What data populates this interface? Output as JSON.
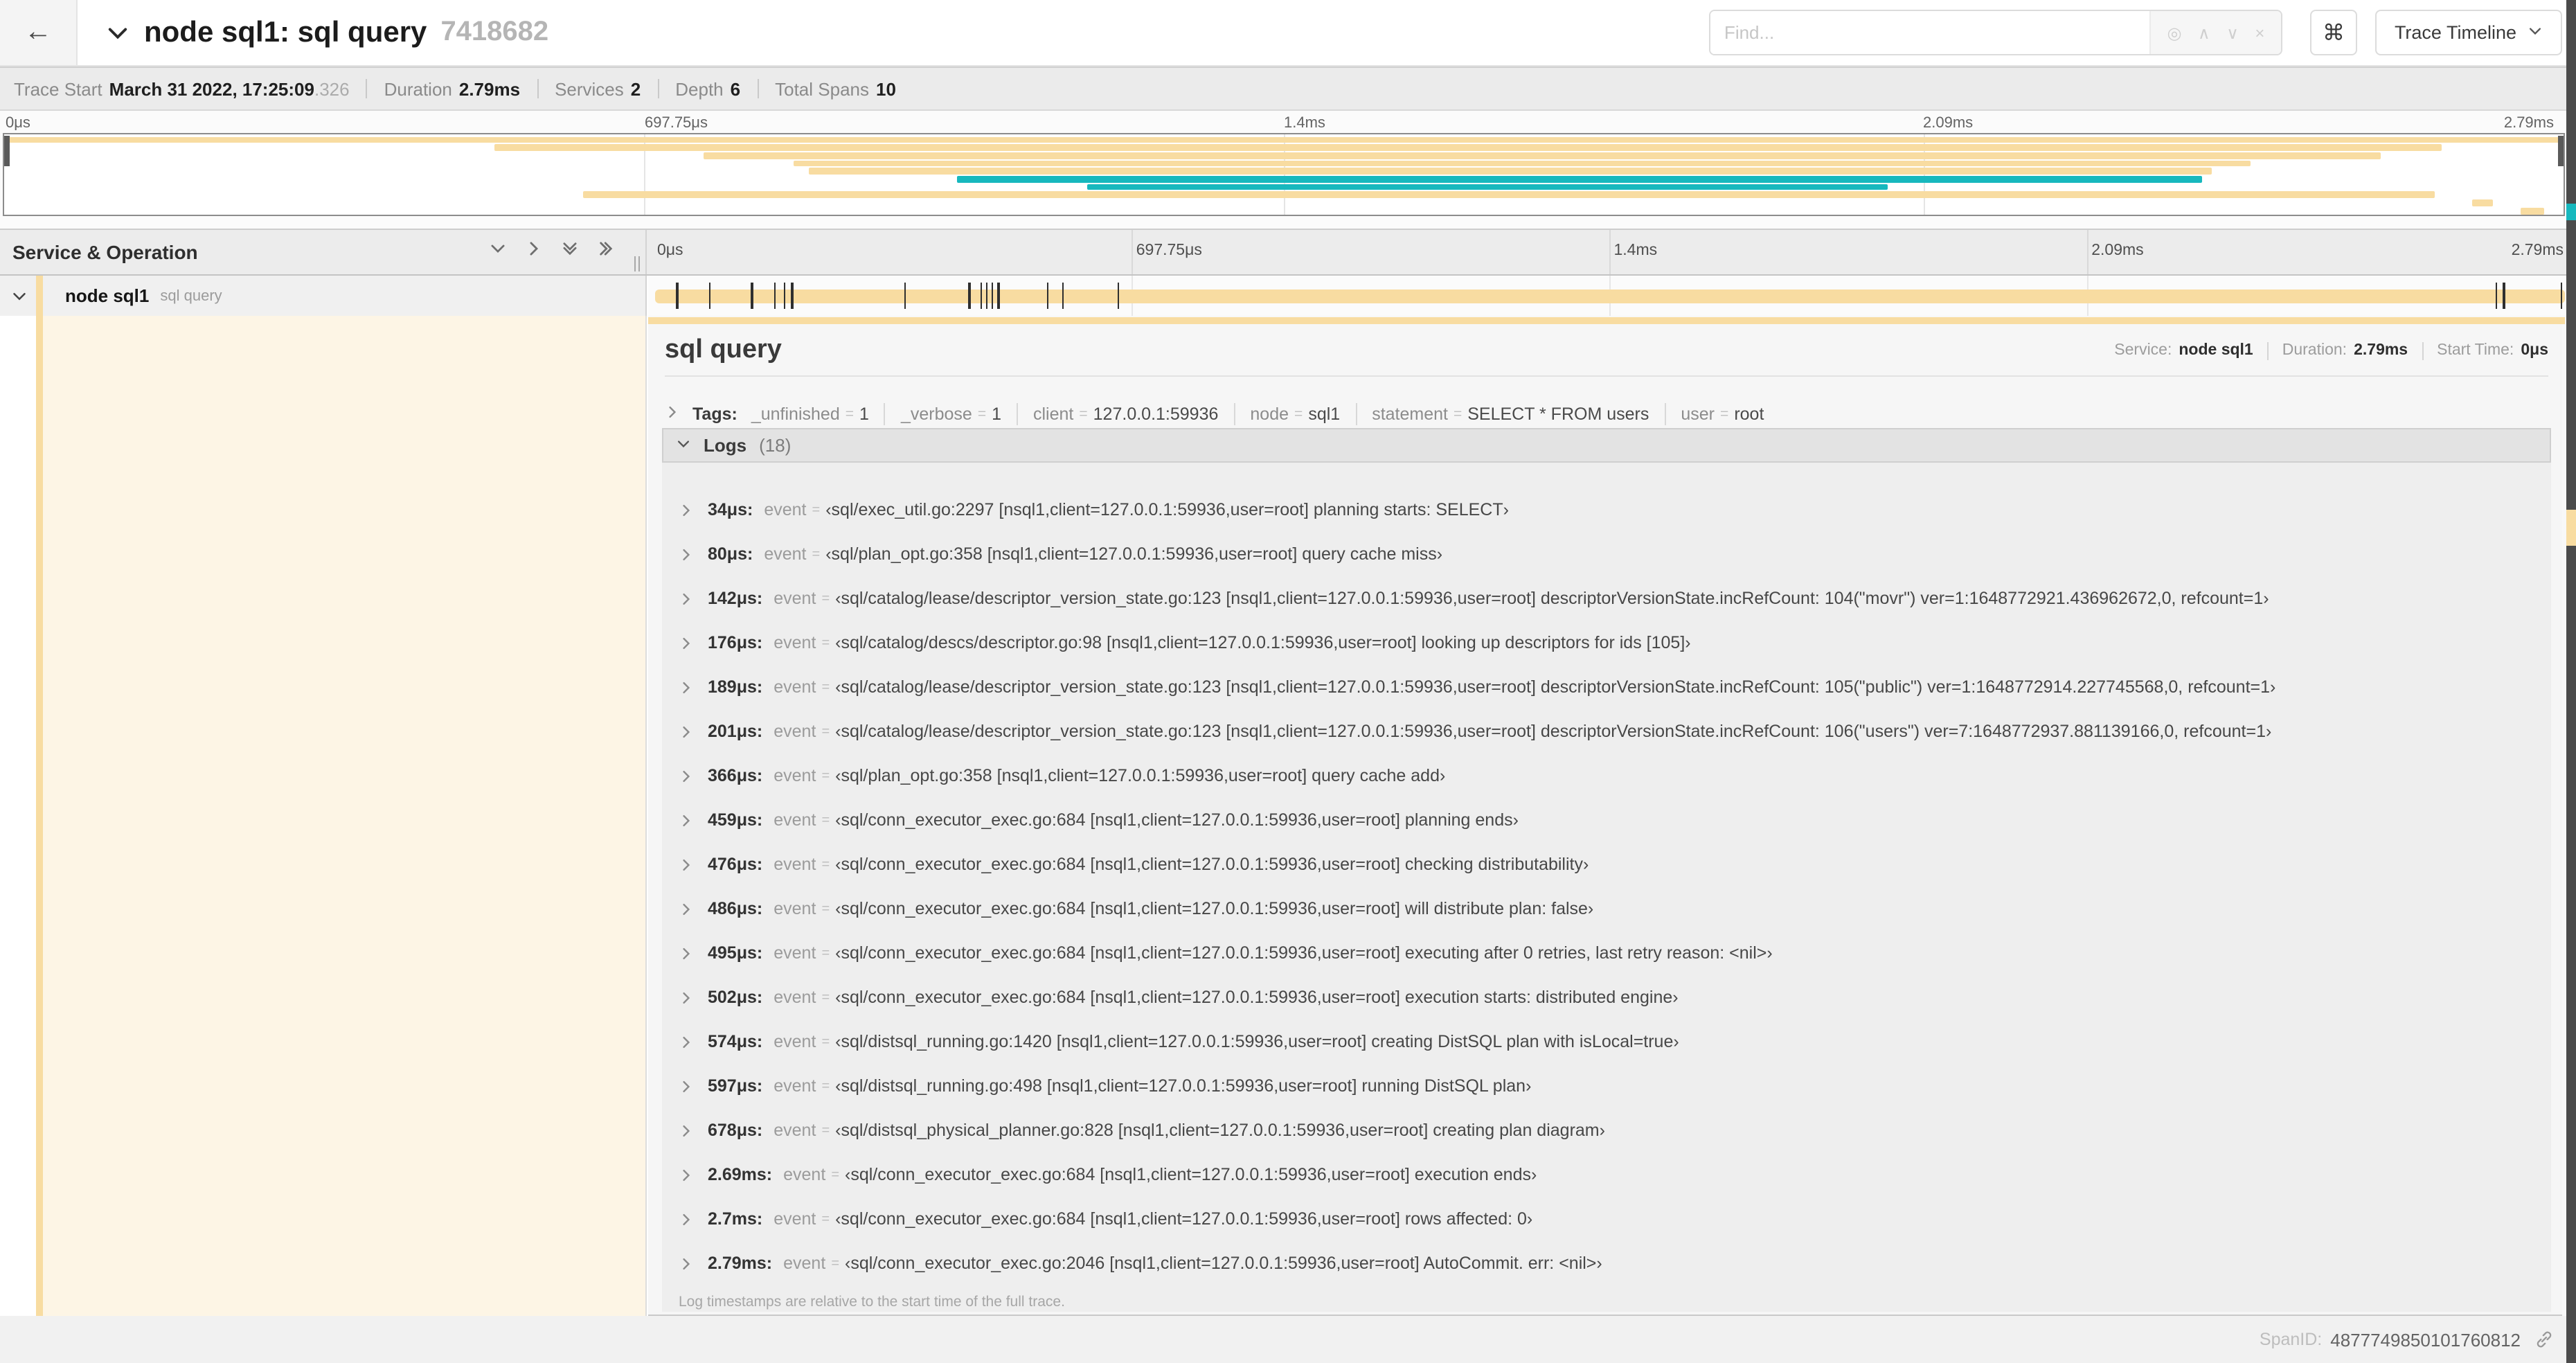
{
  "header": {
    "back_icon": "←",
    "title": "node sql1: sql query",
    "trace_id": "7418682",
    "find_placeholder": "Find...",
    "shortcut_icon": "⌘",
    "view_selector": "Trace Timeline"
  },
  "summary": {
    "trace_start_label": "Trace Start",
    "trace_start_value": "March 31 2022, 17:25:09",
    "trace_start_fraction": ".326",
    "duration_label": "Duration",
    "duration_value": "2.79ms",
    "services_label": "Services",
    "services_value": "2",
    "depth_label": "Depth",
    "depth_value": "6",
    "total_spans_label": "Total Spans",
    "total_spans_value": "10"
  },
  "colors": {
    "tan": "#F8DCA1",
    "teal": "#17B8BE"
  },
  "timeline": {
    "left_header": "Service & Operation",
    "ticks": [
      {
        "label": "0μs",
        "pct": 0
      },
      {
        "label": "697.75μs",
        "pct": 25
      },
      {
        "label": "1.4ms",
        "pct": 50
      },
      {
        "label": "2.09ms",
        "pct": 75
      },
      {
        "label": "2.79ms",
        "pct": 100
      }
    ],
    "row": {
      "service": "node sql1",
      "operation": "sql query"
    },
    "event_marks_pct": [
      1.2,
      2.9,
      5.1,
      6.3,
      6.8,
      7.2,
      13.1,
      16.5,
      17.1,
      17.4,
      17.7,
      18.0,
      20.6,
      21.4,
      24.3,
      96.4,
      96.8,
      99.8
    ]
  },
  "minimap": {
    "spans": [
      {
        "start": 0,
        "end": 100,
        "color": "tan"
      },
      {
        "start": 19.1,
        "end": 95.3,
        "color": "tan"
      },
      {
        "start": 27.3,
        "end": 92.9,
        "color": "tan"
      },
      {
        "start": 30.8,
        "end": 87.8,
        "color": "tan"
      },
      {
        "start": 31.4,
        "end": 86.3,
        "color": "tan"
      },
      {
        "start": 37.2,
        "end": 85.9,
        "color": "teal"
      },
      {
        "start": 42.3,
        "end": 73.6,
        "color": "teal"
      },
      {
        "start": 22.6,
        "end": 95.0,
        "color": "tan"
      },
      {
        "start": 96.5,
        "end": 97.3,
        "color": "tan"
      },
      {
        "start": 98.4,
        "end": 99.3,
        "color": "tan"
      }
    ]
  },
  "detail": {
    "title": "sql query",
    "service_label": "Service:",
    "service_value": "node sql1",
    "duration_label": "Duration:",
    "duration_value": "2.79ms",
    "start_label": "Start Time:",
    "start_value": "0μs",
    "tags_label": "Tags:",
    "tags": [
      {
        "key": "_unfinished",
        "value": "1"
      },
      {
        "key": "_verbose",
        "value": "1"
      },
      {
        "key": "client",
        "value": "127.0.0.1:59936"
      },
      {
        "key": "node",
        "value": "sql1"
      },
      {
        "key": "statement",
        "value": "SELECT * FROM users"
      },
      {
        "key": "user",
        "value": "root"
      }
    ],
    "logs_label": "Logs",
    "logs_count": "(18)",
    "log_field_key": "event",
    "logs": [
      {
        "time": "34μs:",
        "value": "‹sql/exec_util.go:2297 [nsql1,client=127.0.0.1:59936,user=root] planning starts: SELECT›"
      },
      {
        "time": "80μs:",
        "value": "‹sql/plan_opt.go:358 [nsql1,client=127.0.0.1:59936,user=root] query cache miss›"
      },
      {
        "time": "142μs:",
        "value": "‹sql/catalog/lease/descriptor_version_state.go:123 [nsql1,client=127.0.0.1:59936,user=root] descriptorVersionState.incRefCount: 104(\"movr\") ver=1:1648772921.436962672,0, refcount=1›"
      },
      {
        "time": "176μs:",
        "value": "‹sql/catalog/descs/descriptor.go:98 [nsql1,client=127.0.0.1:59936,user=root] looking up descriptors for ids [105]›"
      },
      {
        "time": "189μs:",
        "value": "‹sql/catalog/lease/descriptor_version_state.go:123 [nsql1,client=127.0.0.1:59936,user=root] descriptorVersionState.incRefCount: 105(\"public\") ver=1:1648772914.227745568,0, refcount=1›"
      },
      {
        "time": "201μs:",
        "value": "‹sql/catalog/lease/descriptor_version_state.go:123 [nsql1,client=127.0.0.1:59936,user=root] descriptorVersionState.incRefCount: 106(\"users\") ver=7:1648772937.881139166,0, refcount=1›"
      },
      {
        "time": "366μs:",
        "value": "‹sql/plan_opt.go:358 [nsql1,client=127.0.0.1:59936,user=root] query cache add›"
      },
      {
        "time": "459μs:",
        "value": "‹sql/conn_executor_exec.go:684 [nsql1,client=127.0.0.1:59936,user=root] planning ends›"
      },
      {
        "time": "476μs:",
        "value": "‹sql/conn_executor_exec.go:684 [nsql1,client=127.0.0.1:59936,user=root] checking distributability›"
      },
      {
        "time": "486μs:",
        "value": "‹sql/conn_executor_exec.go:684 [nsql1,client=127.0.0.1:59936,user=root] will distribute plan: false›"
      },
      {
        "time": "495μs:",
        "value": "‹sql/conn_executor_exec.go:684 [nsql1,client=127.0.0.1:59936,user=root] executing after 0 retries, last retry reason: <nil>›"
      },
      {
        "time": "502μs:",
        "value": "‹sql/conn_executor_exec.go:684 [nsql1,client=127.0.0.1:59936,user=root] execution starts: distributed engine›"
      },
      {
        "time": "574μs:",
        "value": "‹sql/distsql_running.go:1420 [nsql1,client=127.0.0.1:59936,user=root] creating DistSQL plan with isLocal=true›"
      },
      {
        "time": "597μs:",
        "value": "‹sql/distsql_running.go:498 [nsql1,client=127.0.0.1:59936,user=root] running DistSQL plan›"
      },
      {
        "time": "678μs:",
        "value": "‹sql/distsql_physical_planner.go:828 [nsql1,client=127.0.0.1:59936,user=root] creating plan diagram›"
      },
      {
        "time": "2.69ms:",
        "value": "‹sql/conn_executor_exec.go:684 [nsql1,client=127.0.0.1:59936,user=root] execution ends›"
      },
      {
        "time": "2.7ms:",
        "value": "‹sql/conn_executor_exec.go:684 [nsql1,client=127.0.0.1:59936,user=root] rows affected: 0›"
      },
      {
        "time": "2.79ms:",
        "value": "‹sql/conn_executor_exec.go:2046 [nsql1,client=127.0.0.1:59936,user=root] AutoCommit. err: <nil>›"
      }
    ],
    "footer_note": "Log timestamps are relative to the start time of the full trace.",
    "spanid_label": "SpanID:",
    "spanid_value": "4877749850101760812"
  }
}
